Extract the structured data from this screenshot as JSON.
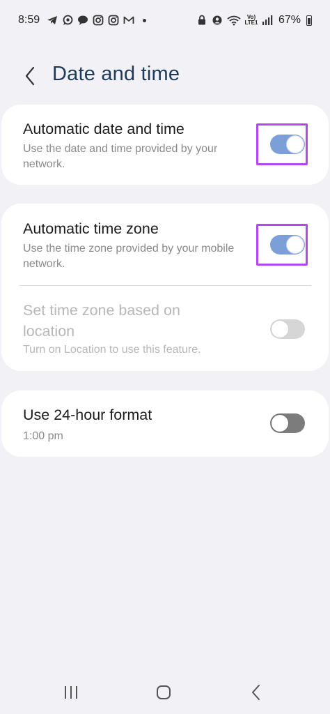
{
  "status_bar": {
    "time": "8:59",
    "icons_left": [
      "telegram-icon",
      "whatsapp-icon",
      "chat-icon",
      "instagram-icon",
      "instagram-icon",
      "gmail-icon"
    ],
    "icons_right": [
      "lock-icon",
      "profile-icon",
      "wifi-icon",
      "volte-icon",
      "signal-icon"
    ],
    "volte_label": "Vo) LTE1",
    "battery": "67%"
  },
  "header": {
    "title": "Date and time"
  },
  "settings": {
    "auto_date_time": {
      "title": "Automatic date and time",
      "subtitle": "Use the date and time provided by your network.",
      "enabled": true
    },
    "auto_time_zone": {
      "title": "Automatic time zone",
      "subtitle": "Use the time zone provided by your mobile network.",
      "enabled": true
    },
    "location_time_zone": {
      "title": "Set time zone based on location",
      "subtitle": "Turn on Location to use this feature.",
      "enabled": false,
      "disabled": true
    },
    "hour_format": {
      "title": "Use 24-hour format",
      "subtitle": "1:00 pm",
      "enabled": false
    }
  },
  "colors": {
    "accent": "#7c9fd8",
    "highlight": "#b249f0",
    "title": "#1e3a5a",
    "background": "#f1f1f6"
  },
  "nav_bar": {
    "icons": [
      "recents-icon",
      "home-icon",
      "back-icon"
    ]
  }
}
